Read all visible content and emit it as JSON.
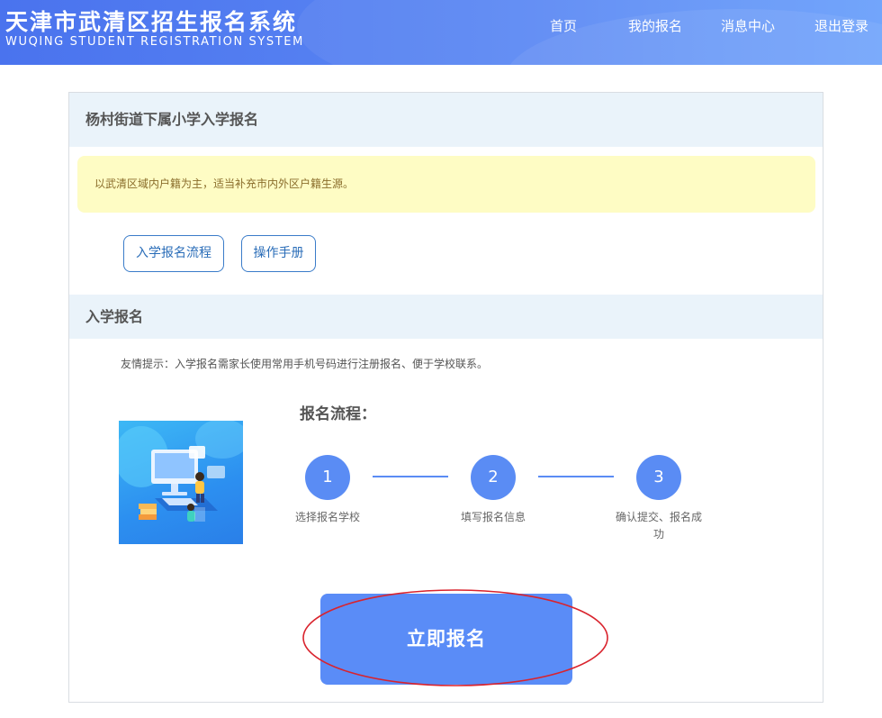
{
  "header": {
    "title": "天津市武清区招生报名系统",
    "subtitle": "WUQING STUDENT REGISTRATION SYSTEM",
    "nav": [
      "首页",
      "我的报名",
      "消息中心",
      "退出登录"
    ]
  },
  "school_section": {
    "title": "杨村街道下属小学入学报名",
    "notice": "以武清区域内户籍为主，适当补充市内外区户籍生源。",
    "buttons": [
      "入学报名流程",
      "操作手册"
    ]
  },
  "enroll_section": {
    "title": "入学报名",
    "tip": "友情提示：入学报名需家长使用常用手机号码进行注册报名、便于学校联系。",
    "flow_title": "报名流程：",
    "steps": [
      {
        "number": "1",
        "label": "选择报名学校"
      },
      {
        "number": "2",
        "label": "填写报名信息"
      },
      {
        "number": "3",
        "label": "确认提交、报名成功"
      }
    ],
    "apply_label": "立即报名"
  },
  "colors": {
    "header_start": "#4a73ee",
    "header_end": "#6aa0fb",
    "accent": "#5a8cf4",
    "notice_bg": "#fefcc4",
    "section_bg": "#eaf3fa",
    "highlight_ring": "#d9232d"
  }
}
